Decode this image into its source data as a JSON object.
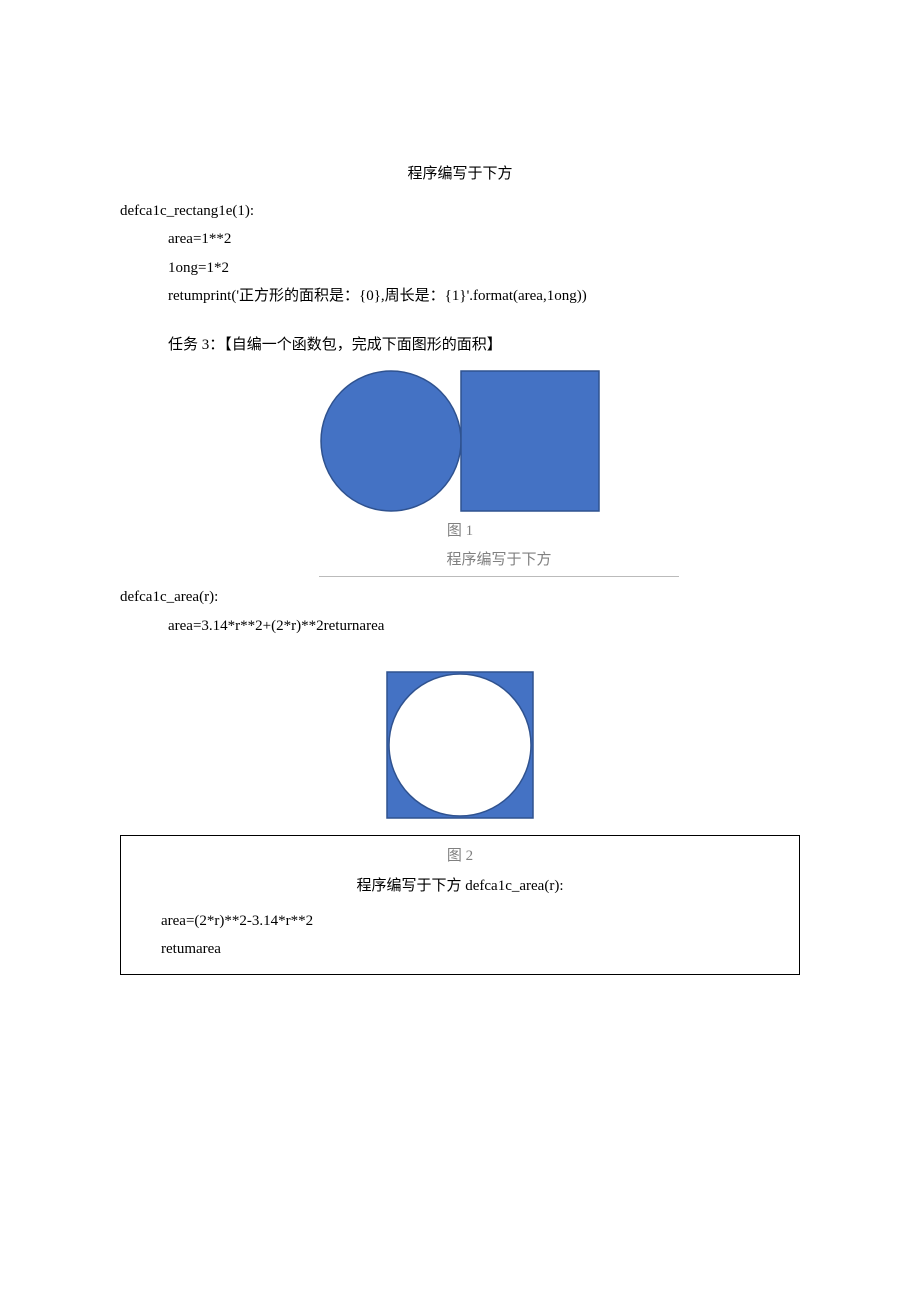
{
  "section1": {
    "title": "程序编写于下方",
    "code": [
      "defca1c_rectang1e(1):",
      "area=1**2",
      "1ong=1*2",
      "retumprint('正方形的面积是：{0},周长是：{1}'.format(area,1ong))"
    ]
  },
  "task3": {
    "label": "任务 3：【自编一个函数包，完成下面图形的面积】"
  },
  "figure1": {
    "caption": "图 1",
    "sub_caption": "程序编写于下方",
    "shape_fill": "#4472C4",
    "shape_stroke": "#2F528F"
  },
  "section2": {
    "code": [
      "defca1c_area(r):",
      "area=3.14*r**2+(2*r)**2returnarea"
    ]
  },
  "figure2": {
    "caption": "图 2",
    "shape_fill": "#4472C4",
    "shape_stroke": "#2F528F",
    "inner_fill": "#FFFFFF"
  },
  "section3": {
    "line_center": "程序编写于下方 defca1c_area(r):",
    "code": [
      "area=(2*r)**2-3.14*r**2",
      "retumarea"
    ]
  }
}
